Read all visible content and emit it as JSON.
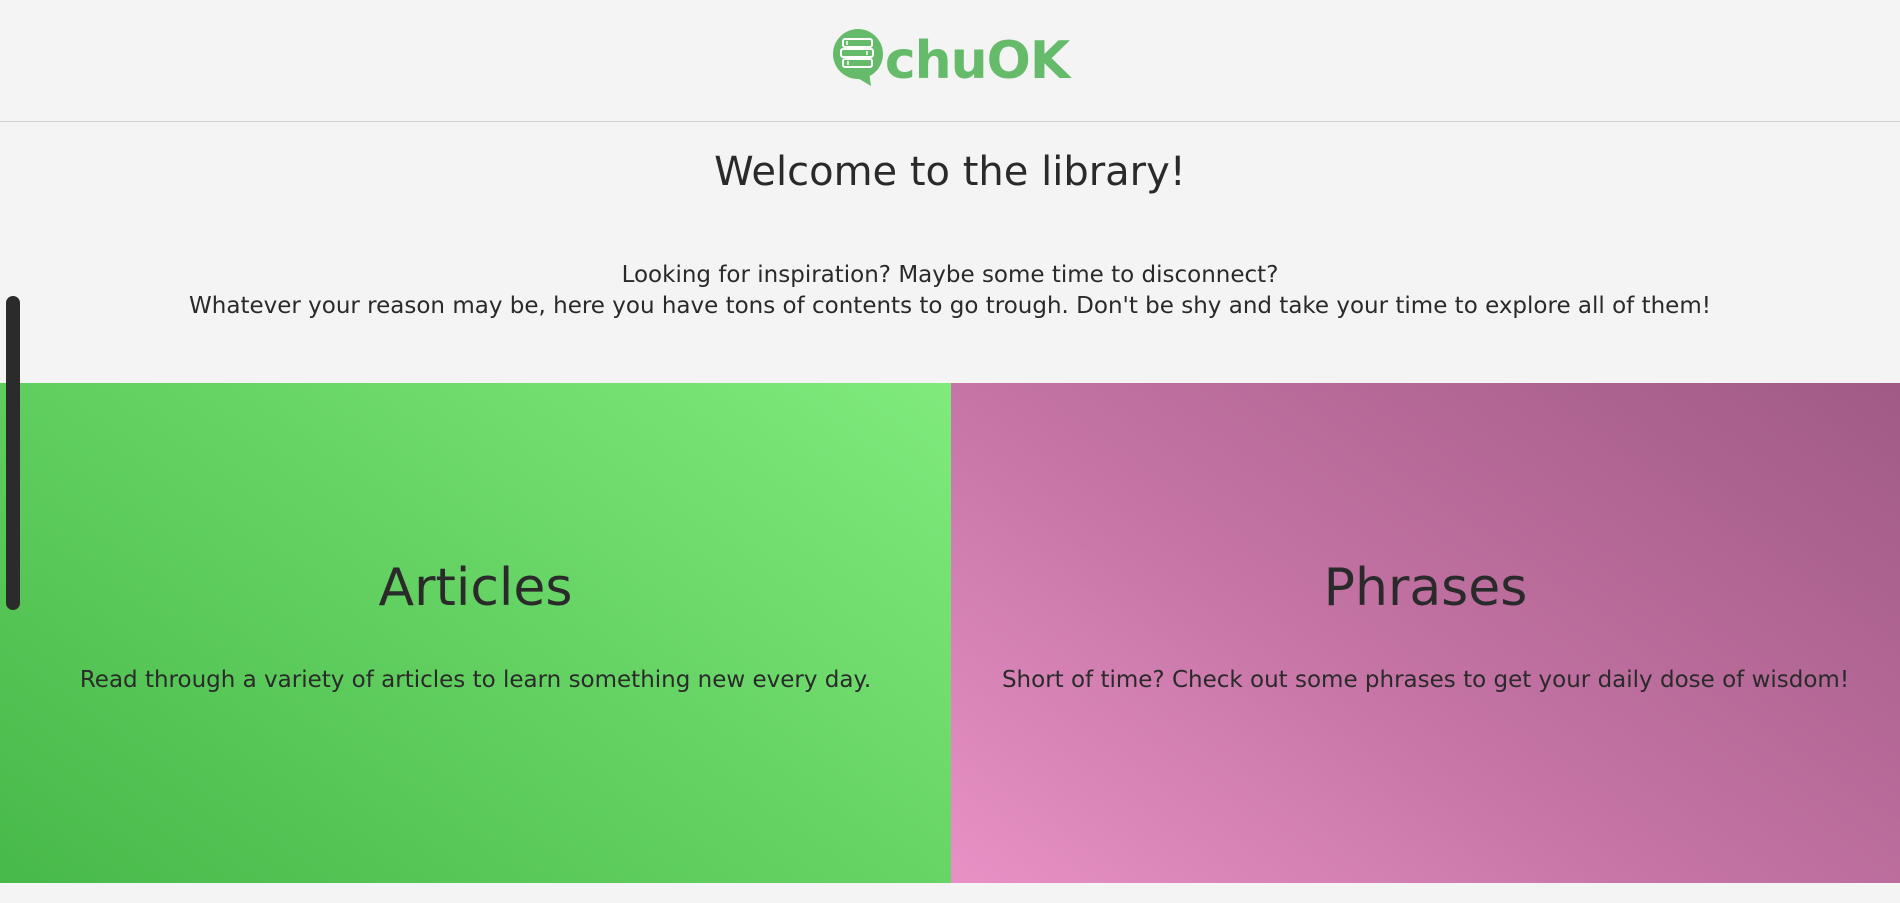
{
  "brand": {
    "logo_text": "chuOK",
    "accent_color": "#66bb6a"
  },
  "hero": {
    "title": "Welcome to the library!",
    "intro_line_1": "Looking for inspiration? Maybe some time to disconnect?",
    "intro_line_2": "Whatever your reason may be, here you have tons of contents to go trough. Don't be shy and take your time to explore all of them!"
  },
  "cards": [
    {
      "title": "Articles",
      "description": "Read through a variety of articles to learn something new every day.",
      "color": "#5fcf5d"
    },
    {
      "title": "Phrases",
      "description": "Short of time? Check out some phrases to get your daily dose of wisdom!",
      "color": "#c676a6"
    }
  ],
  "icons": {
    "logo": "chat-bubble-books-icon"
  }
}
